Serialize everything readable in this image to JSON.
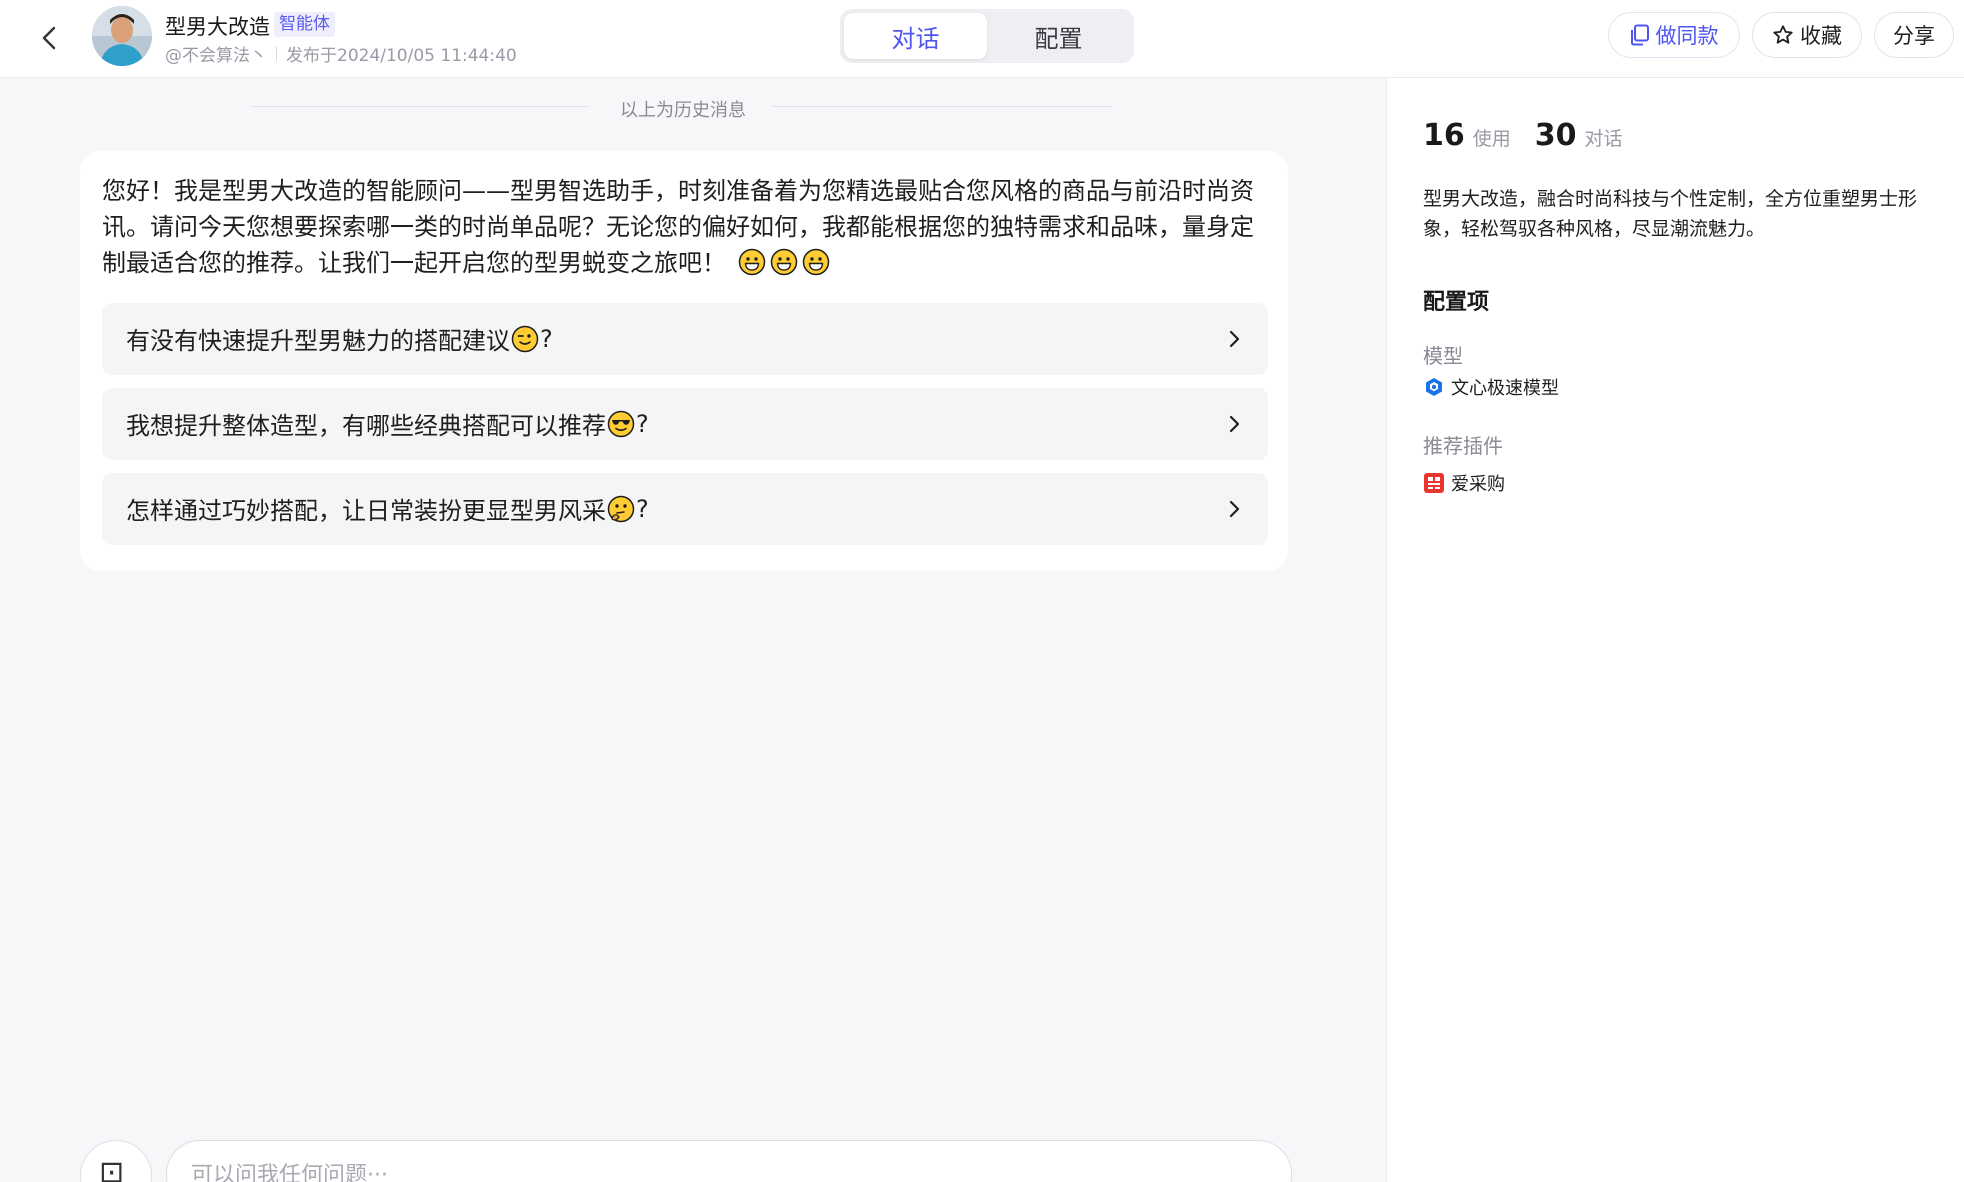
{
  "header": {
    "title": "型男大改造",
    "badge": "智能体",
    "author": "@不会算法丶",
    "published": "发布于2024/10/05 11:44:40",
    "tabs": [
      {
        "label": "对话",
        "active": true
      },
      {
        "label": "配置",
        "active": false
      }
    ],
    "buttons": {
      "copy": "做同款",
      "favorite": "收藏",
      "share": "分享"
    }
  },
  "chat": {
    "history_divider": "以上为历史消息",
    "welcome_text": "您好！我是型男大改造的智能顾问——型男智选助手，时刻准备着为您精选最贴合您风格的商品与前沿时尚资讯。请问今天您想要探索哪一类的时尚单品呢？无论您的偏好如何，我都能根据您的独特需求和品味，量身定制最适合您的推荐。让我们一起开启您的型男蜕变之旅吧！",
    "welcome_emojis": [
      "grinning-face",
      "grinning-face",
      "grinning-face"
    ],
    "suggestions": [
      {
        "text": "有没有快速提升型男魅力的搭配建议",
        "emoji": "winking-face",
        "suffix": "?"
      },
      {
        "text": "我想提升整体造型，有哪些经典搭配可以推荐",
        "emoji": "sunglasses-face",
        "suffix": "?"
      },
      {
        "text": "怎样通过巧妙搭配，让日常装扮更显型男风采",
        "emoji": "thinking-face",
        "suffix": "?"
      }
    ],
    "input": {
      "placeholder": "可以问我任何问题···",
      "value": ""
    }
  },
  "side": {
    "uses_num": "16",
    "uses_label": "使用",
    "chats_num": "30",
    "chats_label": "对话",
    "description": "型男大改造，融合时尚科技与个性定制，全方位重塑男士形象，轻松驾驭各种风格，尽显潮流魅力。",
    "config_title": "配置项",
    "model_label": "模型",
    "model_name": "文心极速模型",
    "plugin_label": "推荐插件",
    "plugin_name": "爱采购"
  },
  "colors": {
    "accent": "#4f55f1",
    "plugin_red": "#e8352f",
    "model_blue": "#1a73e8"
  }
}
